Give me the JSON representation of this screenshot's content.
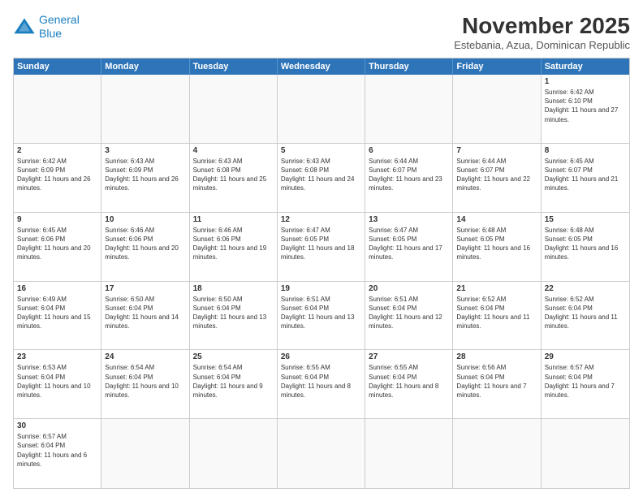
{
  "header": {
    "logo_line1": "General",
    "logo_line2": "Blue",
    "month_title": "November 2025",
    "subtitle": "Estebania, Azua, Dominican Republic"
  },
  "day_headers": [
    "Sunday",
    "Monday",
    "Tuesday",
    "Wednesday",
    "Thursday",
    "Friday",
    "Saturday"
  ],
  "weeks": [
    [
      {
        "date": "",
        "empty": true
      },
      {
        "date": "",
        "empty": true
      },
      {
        "date": "",
        "empty": true
      },
      {
        "date": "",
        "empty": true
      },
      {
        "date": "",
        "empty": true
      },
      {
        "date": "",
        "empty": true
      },
      {
        "date": "1",
        "sunrise": "6:42 AM",
        "sunset": "6:10 PM",
        "daylight": "11 hours and 27 minutes."
      }
    ],
    [
      {
        "date": "2",
        "sunrise": "6:42 AM",
        "sunset": "6:09 PM",
        "daylight": "11 hours and 26 minutes."
      },
      {
        "date": "3",
        "sunrise": "6:43 AM",
        "sunset": "6:09 PM",
        "daylight": "11 hours and 26 minutes."
      },
      {
        "date": "4",
        "sunrise": "6:43 AM",
        "sunset": "6:08 PM",
        "daylight": "11 hours and 25 minutes."
      },
      {
        "date": "5",
        "sunrise": "6:43 AM",
        "sunset": "6:08 PM",
        "daylight": "11 hours and 24 minutes."
      },
      {
        "date": "6",
        "sunrise": "6:44 AM",
        "sunset": "6:07 PM",
        "daylight": "11 hours and 23 minutes."
      },
      {
        "date": "7",
        "sunrise": "6:44 AM",
        "sunset": "6:07 PM",
        "daylight": "11 hours and 22 minutes."
      },
      {
        "date": "8",
        "sunrise": "6:45 AM",
        "sunset": "6:07 PM",
        "daylight": "11 hours and 21 minutes."
      }
    ],
    [
      {
        "date": "9",
        "sunrise": "6:45 AM",
        "sunset": "6:06 PM",
        "daylight": "11 hours and 20 minutes."
      },
      {
        "date": "10",
        "sunrise": "6:46 AM",
        "sunset": "6:06 PM",
        "daylight": "11 hours and 20 minutes."
      },
      {
        "date": "11",
        "sunrise": "6:46 AM",
        "sunset": "6:06 PM",
        "daylight": "11 hours and 19 minutes."
      },
      {
        "date": "12",
        "sunrise": "6:47 AM",
        "sunset": "6:05 PM",
        "daylight": "11 hours and 18 minutes."
      },
      {
        "date": "13",
        "sunrise": "6:47 AM",
        "sunset": "6:05 PM",
        "daylight": "11 hours and 17 minutes."
      },
      {
        "date": "14",
        "sunrise": "6:48 AM",
        "sunset": "6:05 PM",
        "daylight": "11 hours and 16 minutes."
      },
      {
        "date": "15",
        "sunrise": "6:48 AM",
        "sunset": "6:05 PM",
        "daylight": "11 hours and 16 minutes."
      }
    ],
    [
      {
        "date": "16",
        "sunrise": "6:49 AM",
        "sunset": "6:04 PM",
        "daylight": "11 hours and 15 minutes."
      },
      {
        "date": "17",
        "sunrise": "6:50 AM",
        "sunset": "6:04 PM",
        "daylight": "11 hours and 14 minutes."
      },
      {
        "date": "18",
        "sunrise": "6:50 AM",
        "sunset": "6:04 PM",
        "daylight": "11 hours and 13 minutes."
      },
      {
        "date": "19",
        "sunrise": "6:51 AM",
        "sunset": "6:04 PM",
        "daylight": "11 hours and 13 minutes."
      },
      {
        "date": "20",
        "sunrise": "6:51 AM",
        "sunset": "6:04 PM",
        "daylight": "11 hours and 12 minutes."
      },
      {
        "date": "21",
        "sunrise": "6:52 AM",
        "sunset": "6:04 PM",
        "daylight": "11 hours and 11 minutes."
      },
      {
        "date": "22",
        "sunrise": "6:52 AM",
        "sunset": "6:04 PM",
        "daylight": "11 hours and 11 minutes."
      }
    ],
    [
      {
        "date": "23",
        "sunrise": "6:53 AM",
        "sunset": "6:04 PM",
        "daylight": "11 hours and 10 minutes."
      },
      {
        "date": "24",
        "sunrise": "6:54 AM",
        "sunset": "6:04 PM",
        "daylight": "11 hours and 10 minutes."
      },
      {
        "date": "25",
        "sunrise": "6:54 AM",
        "sunset": "6:04 PM",
        "daylight": "11 hours and 9 minutes."
      },
      {
        "date": "26",
        "sunrise": "6:55 AM",
        "sunset": "6:04 PM",
        "daylight": "11 hours and 8 minutes."
      },
      {
        "date": "27",
        "sunrise": "6:55 AM",
        "sunset": "6:04 PM",
        "daylight": "11 hours and 8 minutes."
      },
      {
        "date": "28",
        "sunrise": "6:56 AM",
        "sunset": "6:04 PM",
        "daylight": "11 hours and 7 minutes."
      },
      {
        "date": "29",
        "sunrise": "6:57 AM",
        "sunset": "6:04 PM",
        "daylight": "11 hours and 7 minutes."
      }
    ],
    [
      {
        "date": "30",
        "sunrise": "6:57 AM",
        "sunset": "6:04 PM",
        "daylight": "11 hours and 6 minutes."
      },
      {
        "date": "",
        "empty": true
      },
      {
        "date": "",
        "empty": true
      },
      {
        "date": "",
        "empty": true
      },
      {
        "date": "",
        "empty": true
      },
      {
        "date": "",
        "empty": true
      },
      {
        "date": "",
        "empty": true
      }
    ]
  ]
}
